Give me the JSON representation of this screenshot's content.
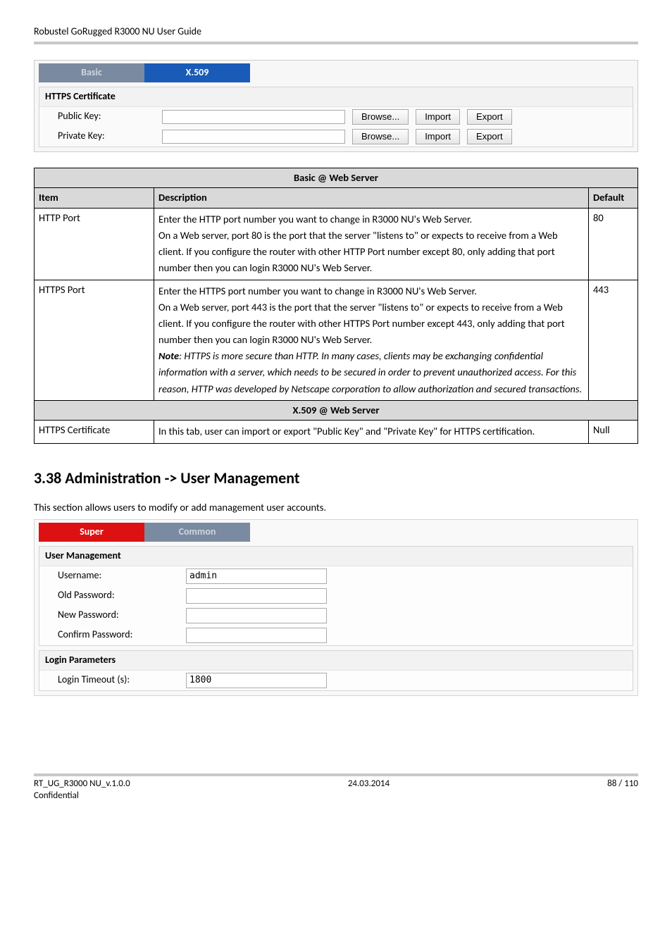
{
  "header": {
    "title": "Robustel GoRugged R3000 NU User Guide"
  },
  "cert_panel": {
    "tabs": {
      "basic": "Basic",
      "x509": "X.509"
    },
    "group_title": "HTTPS Certificate",
    "rows": {
      "public": {
        "label": "Public Key:",
        "browse": "Browse...",
        "import": "Import",
        "export": "Export"
      },
      "private": {
        "label": "Private Key:",
        "browse": "Browse...",
        "import": "Import",
        "export": "Export"
      }
    }
  },
  "webserver_table": {
    "section1_title": "Basic @ Web Server",
    "col_item": "Item",
    "col_desc": "Description",
    "col_default": "Default",
    "rows": [
      {
        "item": "HTTP Port",
        "desc_plain": "Enter the HTTP port number you want to change in R3000 NU's Web Server.\nOn a Web server, port 80 is the port that the server \"listens to\" or expects to receive from a Web client. If you configure the router with other HTTP Port number except 80, only adding that port number then you can login R3000 NU's Web Server.",
        "default": "80"
      },
      {
        "item": "HTTPS Port",
        "desc_plain": "Enter the HTTPS port number you want to change in R3000 NU's Web Server.\nOn a Web server, port 443 is the port that the server \"listens to\" or expects to receive from a Web client. If you configure the router with other HTTPS Port number except 443, only adding that port number then you can login R3000 NU's Web Server.",
        "note_label": "Note",
        "note_text": ": HTTPS is more secure than HTTP. In many cases, clients may be exchanging confidential information with a server, which needs to be secured in order to prevent unauthorized access. For this reason, HTTP was developed by Netscape corporation to allow authorization and secured transactions.",
        "default": "443"
      }
    ],
    "section2_title": "X.509 @ Web Server",
    "row3": {
      "item": "HTTPS Certificate",
      "desc": "In this tab, user can import or export \"Public Key\" and \"Private Key\" for HTTPS certification.",
      "default": "Null"
    }
  },
  "section_heading": "3.38  Administration -> User Management",
  "um_intro": "This section allows users to modify or add management user accounts.",
  "um_panel": {
    "tabs": {
      "super": "Super",
      "common": "Common"
    },
    "group1_title": "User Management",
    "fields": {
      "username_label": "Username:",
      "username_value": "admin",
      "oldpw_label": "Old Password:",
      "newpw_label": "New Password:",
      "confirmpw_label": "Confirm Password:"
    },
    "group2_title": "Login Parameters",
    "login_timeout_label": "Login Timeout (s):",
    "login_timeout_value": "1800"
  },
  "footer": {
    "left": "RT_UG_R3000 NU_v.1.0.0",
    "center": "24.03.2014",
    "right": "88 / 110",
    "conf": "Confidential"
  }
}
